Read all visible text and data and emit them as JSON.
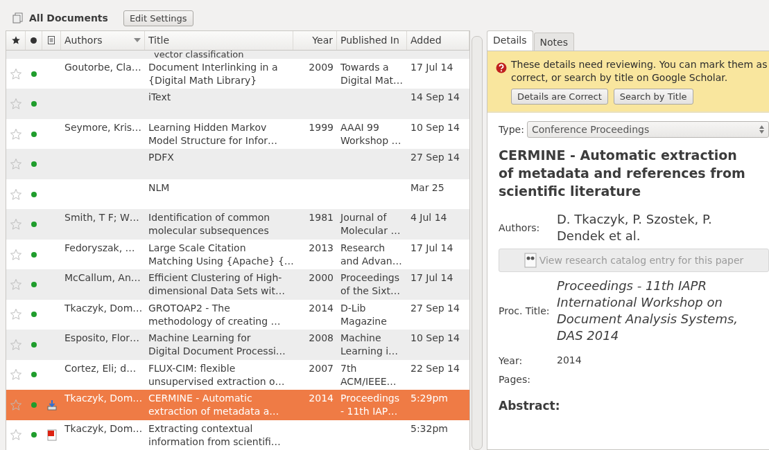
{
  "toolbar": {
    "collection": "All Documents",
    "button": "Edit Settings"
  },
  "table": {
    "columns": [
      {
        "kind": "star"
      },
      {
        "kind": "dot"
      },
      {
        "kind": "file"
      },
      {
        "kind": "text",
        "label": "Authors",
        "sorted": true
      },
      {
        "kind": "text",
        "label": "Title",
        "sorted": false
      },
      {
        "kind": "text",
        "label": "Year",
        "sorted": false
      },
      {
        "kind": "text",
        "label": "Published In",
        "sorted": false
      },
      {
        "kind": "text",
        "label": "Added",
        "sorted": false
      }
    ],
    "partial_row": "vector classification",
    "rows": [
      {
        "starred": false,
        "unread": true,
        "selected": false,
        "authors": "Goutorbe, Cla…",
        "title": [
          "Document Interlinking in a",
          "{Digital Math Library}"
        ],
        "year": "2009",
        "published": [
          "Towards a",
          "Digital Mat…"
        ],
        "added": "17 Jul 14"
      },
      {
        "starred": false,
        "unread": true,
        "selected": false,
        "authors": "",
        "title": [
          "iText"
        ],
        "year": "",
        "published": [],
        "added": "14 Sep 14"
      },
      {
        "starred": false,
        "unread": true,
        "selected": false,
        "authors": "Seymore, Kris…",
        "title": [
          "Learning Hidden Markov",
          "Model Structure for Infor…"
        ],
        "year": "1999",
        "published": [
          "AAAI 99",
          "Workshop …"
        ],
        "added": "10 Sep 14"
      },
      {
        "starred": false,
        "unread": true,
        "selected": false,
        "authors": "",
        "title": [
          "PDFX"
        ],
        "year": "",
        "published": [],
        "added": "27 Sep 14"
      },
      {
        "starred": false,
        "unread": true,
        "selected": false,
        "authors": "",
        "title": [
          "NLM"
        ],
        "year": "",
        "published": [],
        "added": "Mar 25"
      },
      {
        "starred": false,
        "unread": true,
        "selected": false,
        "authors": "Smith, T F; W…",
        "title": [
          "Identification of common",
          "molecular subsequences"
        ],
        "year": "1981",
        "published": [
          "Journal of",
          "Molecular …"
        ],
        "added": "4 Jul 14"
      },
      {
        "starred": false,
        "unread": true,
        "selected": false,
        "authors": "Fedoryszak, …",
        "title": [
          "Large Scale Citation",
          "Matching Using {Apache} {…"
        ],
        "year": "2013",
        "published": [
          "Research",
          "and Advan…"
        ],
        "added": "17 Jul 14"
      },
      {
        "starred": false,
        "unread": true,
        "selected": false,
        "authors": "McCallum, An…",
        "title": [
          "Efficient Clustering of High-",
          "dimensional Data Sets wit…"
        ],
        "year": "2000",
        "published": [
          "Proceedings",
          "of the Sixt…"
        ],
        "added": "17 Jul 14"
      },
      {
        "starred": false,
        "unread": true,
        "selected": false,
        "authors": "Tkaczyk, Dom…",
        "title": [
          "GROTOAP2 - The",
          "methodology of creating …"
        ],
        "year": "2014",
        "published": [
          "D-Lib",
          "Magazine"
        ],
        "added": "27 Sep 14"
      },
      {
        "starred": false,
        "unread": true,
        "selected": false,
        "authors": "Esposito, Flor…",
        "title": [
          "Machine Learning for",
          "Digital Document Processi…"
        ],
        "year": "2008",
        "published": [
          "Machine",
          "Learning i…"
        ],
        "added": "10 Sep 14"
      },
      {
        "starred": false,
        "unread": true,
        "selected": false,
        "authors": "Cortez, Eli; d…",
        "title": [
          "FLUX-CIM: flexible",
          "unsupervised extraction o…"
        ],
        "year": "2007",
        "published": [
          "7th",
          "ACM/IEEE…"
        ],
        "added": "22 Sep 14"
      },
      {
        "starred": false,
        "unread": true,
        "attachment": {
          "kind": "download"
        },
        "selected": true,
        "authors": "Tkaczyk, Dom…",
        "title": [
          "CERMINE - Automatic",
          "extraction of metadata a…"
        ],
        "year": "2014",
        "published": [
          "Proceedings",
          "- 11th IAP…"
        ],
        "added": "5:29pm"
      },
      {
        "starred": false,
        "unread": true,
        "attachment": {
          "kind": "pdf"
        },
        "selected": false,
        "authors": "Tkaczyk, Dom…",
        "title": [
          "Extracting contextual",
          "information from scientifi…"
        ],
        "year": "",
        "published": [],
        "added": "5:32pm"
      }
    ]
  },
  "details": {
    "tabs": [
      {
        "label": "Details",
        "selected": true
      },
      {
        "label": "Notes",
        "selected": false
      }
    ],
    "notice": {
      "text": "These details need reviewing. You can mark them as correct, or search by title on Google Scholar.",
      "buttons": [
        "Details are Correct",
        "Search by Title"
      ]
    },
    "type_label": "Type:",
    "type_value": "Conference Proceedings",
    "title": "CERMINE - Automatic extraction of metadata and references from scientific literature",
    "authors_label": "Authors:",
    "authors": "D. Tkaczyk, P. Szostek, P. Dendek et al.",
    "catalog_button": "View research catalog entry for this paper",
    "fields": [
      {
        "label": "Proc. Title:",
        "value": "Proceedings - 11th IAPR International Workshop on Document Analysis Systems, DAS 2014",
        "kind": "italic"
      },
      {
        "label": "Year:",
        "value": "2014",
        "kind": "plain"
      },
      {
        "label": "Pages:"
      }
    ],
    "abstract_label": "Abstract:"
  }
}
